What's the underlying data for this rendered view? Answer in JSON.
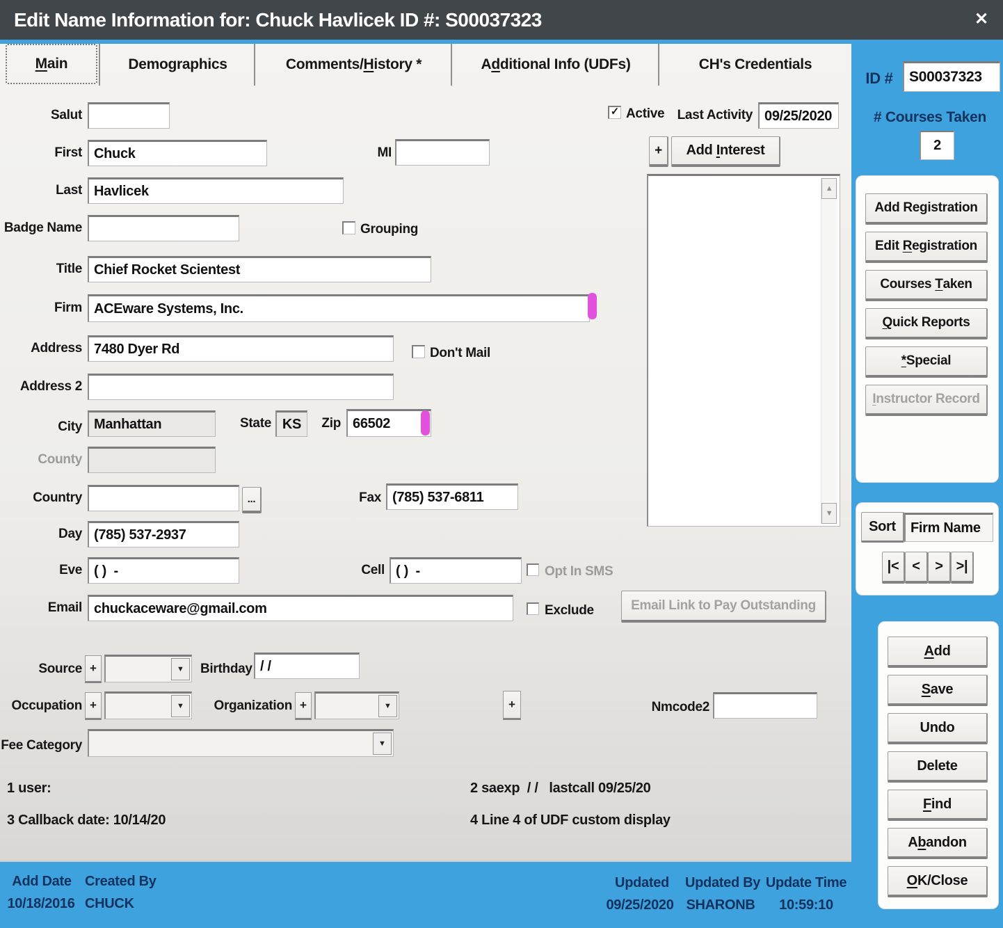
{
  "colors": {
    "accent_blue": "#3ea2de",
    "titlebar": "#41464b",
    "navy_text": "#14325e",
    "cursor_pink": "#e352de"
  },
  "window": {
    "title": "Edit Name Information for: Chuck Havlicek ID #: S00037323",
    "close_icon": "✕"
  },
  "tabs": {
    "main": {
      "pre": "",
      "key": "M",
      "post": "ain"
    },
    "demographics": {
      "pre": "Demographics",
      "key": "",
      "post": ""
    },
    "comments": {
      "pre": "Comments/",
      "key": "H",
      "post": "istory *"
    },
    "additional": {
      "pre": "A",
      "key": "d",
      "post": "ditional Info (UDFs)"
    },
    "credentials": {
      "pre": "CH's Credentials",
      "key": "",
      "post": ""
    }
  },
  "header": {
    "active_label": "Active",
    "active_checked": "✓",
    "last_activity_label": "Last Activity",
    "last_activity_value": "09/25/2020",
    "plus": "+",
    "add_interest": {
      "pre": "Add ",
      "key": "I",
      "post": "nterest"
    }
  },
  "id_panel": {
    "id_label": "ID #",
    "id_value": "S00037323",
    "courses_label": "# Courses Taken",
    "courses_value": "2"
  },
  "form": {
    "salut": {
      "label": "Salut",
      "value": ""
    },
    "first": {
      "label": "First",
      "value": "Chuck"
    },
    "mi": {
      "label": "MI",
      "value": ""
    },
    "last": {
      "label": "Last",
      "value": "Havlicek"
    },
    "badge": {
      "label": "Badge Name",
      "value": ""
    },
    "grouping": {
      "label": "Grouping"
    },
    "title": {
      "label": "Title",
      "value": "Chief Rocket Scientest"
    },
    "firm": {
      "label": "Firm",
      "value": "ACEware Systems, Inc."
    },
    "address": {
      "label": "Address",
      "value": "7480 Dyer Rd"
    },
    "dont_mail": {
      "label": "Don't Mail"
    },
    "address2": {
      "label": "Address 2",
      "value": ""
    },
    "city": {
      "label": "City",
      "value": "Manhattan"
    },
    "state": {
      "label": "State",
      "value": "KS"
    },
    "zip": {
      "label": "Zip",
      "value": "66502"
    },
    "county": {
      "label": "County",
      "value": ""
    },
    "country": {
      "label": "Country",
      "value": "",
      "browse": "..."
    },
    "fax": {
      "label": "Fax",
      "value": "(785) 537-6811"
    },
    "day": {
      "label": "Day",
      "value": "(785) 537-2937"
    },
    "eve": {
      "label": "Eve",
      "value": "( )  -"
    },
    "cell": {
      "label": "Cell",
      "value": "( )  -"
    },
    "opt_sms": {
      "label": "Opt In SMS"
    },
    "email": {
      "label": "Email",
      "value": "chuckaceware@gmail.com"
    },
    "exclude": {
      "label": "Exclude"
    },
    "email_link_label": "Email Link to Pay Outstanding",
    "source": {
      "label": "Source",
      "plus": "+",
      "value": ""
    },
    "birthday": {
      "label": "Birthday",
      "value": "/ /"
    },
    "occupation": {
      "label": "Occupation",
      "plus": "+",
      "value": ""
    },
    "organization": {
      "label": "Organization",
      "plus": "+",
      "value": ""
    },
    "extra_plus": "+",
    "nmcode2": {
      "label": "Nmcode2",
      "value": ""
    },
    "fee_category": {
      "label": "Fee Category",
      "value": ""
    }
  },
  "status": {
    "line1": "1 user:",
    "line2": "2 saexp  / /   lastcall 09/25/20",
    "line3": "3 Callback date: 10/14/20",
    "line4": "4 Line 4 of UDF custom display"
  },
  "side_buttons": {
    "add_registration": {
      "pre": "Add Registration",
      "key": "",
      "post": ""
    },
    "edit_registration": {
      "pre": "Edit ",
      "key": "R",
      "post": "egistration"
    },
    "courses_taken": {
      "pre": "Courses ",
      "key": "T",
      "post": "aken"
    },
    "quick_reports": {
      "pre": "",
      "key": "Q",
      "post": "uick Reports"
    },
    "special": {
      "pre": "",
      "key": "*",
      "post": "Special"
    },
    "instructor_record": {
      "pre": "",
      "key": "I",
      "post": "nstructor Record"
    }
  },
  "sort": {
    "label": "Sort",
    "value": "Firm Name",
    "nav_first": "|<",
    "nav_prev": "<",
    "nav_next": ">",
    "nav_last": ">|"
  },
  "actions": {
    "add": {
      "pre": "",
      "key": "A",
      "post": "dd"
    },
    "save": {
      "pre": "",
      "key": "S",
      "post": "ave"
    },
    "undo": {
      "pre": "Undo",
      "key": "",
      "post": ""
    },
    "delete": {
      "pre": "Delete",
      "key": "",
      "post": ""
    },
    "find": {
      "pre": "",
      "key": "F",
      "post": "ind"
    },
    "abandon": {
      "pre": "A",
      "key": "b",
      "post": "andon"
    },
    "ok_close": {
      "pre": "",
      "key": "O",
      "post": "K/Close"
    }
  },
  "footer": {
    "add_date_label": "Add Date",
    "add_date_value": "10/18/2016",
    "created_by_label": "Created By",
    "created_by_value": "CHUCK",
    "updated_label": "Updated",
    "updated_value": "09/25/2020",
    "updated_by_label": "Updated By",
    "updated_by_value": "SHARONB",
    "update_time_label": "Update Time",
    "update_time_value": "10:59:10"
  },
  "scrollbar": {
    "up": "▲",
    "down": "▼"
  },
  "dropdown_arrow": "▼"
}
